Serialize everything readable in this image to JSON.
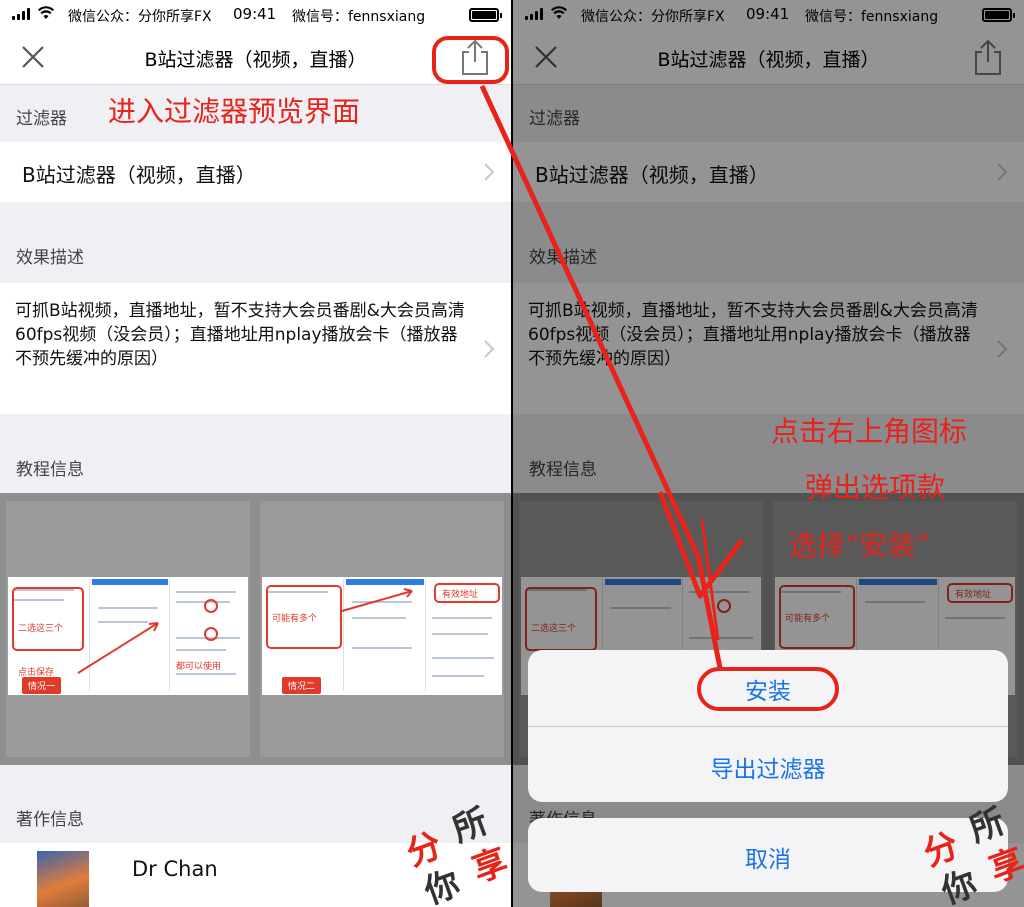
{
  "status_bar": {
    "carrier": "微信公众：分你所享FX",
    "time": "09:41",
    "wechat_id": "微信号：fennsxiang"
  },
  "nav": {
    "title": "B站过滤器（视频，直播）",
    "close_icon": "close-icon",
    "share_icon": "share-icon"
  },
  "sections": {
    "filter_header": "过滤器",
    "filter_name": "B站过滤器（视频，直播）",
    "desc_header": "效果描述",
    "desc_text": "可抓B站视频，直播地址，暂不支持大会员番剧&大会员高清60fps视频（没会员）；直播地址用nplay播放会卡（播放器不预先缓冲的原因）",
    "tutorial_header": "教程信息",
    "author_header": "著作信息",
    "author_name": "Dr Chan"
  },
  "thumbnails": [
    {
      "tag": "情况一",
      "notes": [
        "二选这三个",
        "点击保存",
        "都可以使用"
      ]
    },
    {
      "tag": "情况二",
      "notes": [
        "可能有多个",
        "有效地址"
      ]
    }
  ],
  "action_sheet": {
    "install": "安装",
    "export": "导出过滤器",
    "cancel": "取消"
  },
  "annotations": {
    "left_hint": "进入过滤器预览界面",
    "right_hint_1": "点击右上角图标",
    "right_hint_2": "弹出选项款",
    "right_hint_3": "选择“安装”"
  },
  "watermark": {
    "chars": [
      "分",
      "所",
      "你",
      "享"
    ]
  },
  "colors": {
    "annotation_red": "#e8231a",
    "ios_blue": "#1a73e8",
    "group_bg": "#efeff4"
  }
}
